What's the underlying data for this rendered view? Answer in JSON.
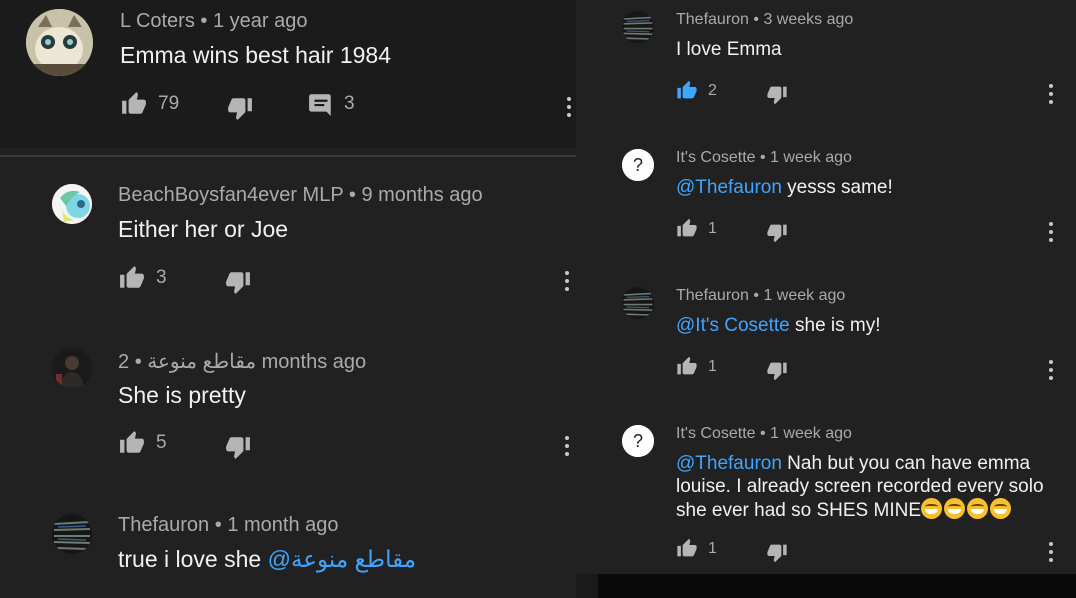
{
  "left": {
    "comments": [
      {
        "author": "L Coters",
        "time": "1 year ago",
        "text": "Emma wins best hair 1984",
        "likes": "79",
        "replies": "3",
        "avatar": "avatar-cat"
      },
      {
        "author": "BeachBoysfan4ever MLP",
        "time": "9 months ago",
        "text": "Either her or Joe",
        "likes": "3",
        "avatar": "avatar-pony"
      },
      {
        "author": "مقاطع منوعة",
        "time": "2 months ago",
        "text": "She is pretty",
        "likes": "5",
        "avatar": "avatar-dark"
      },
      {
        "author": "Thefauron",
        "time": "1 month ago",
        "text": "true i love she ",
        "mention": "@مقاطع منوعة",
        "avatar": "avatar-dark-lines"
      }
    ]
  },
  "right": {
    "comments": [
      {
        "author": "Thefauron",
        "time": "3 weeks ago",
        "text": "I love Emma",
        "likes": "2",
        "liked": true,
        "avatar": "avatar-dark-lines"
      },
      {
        "author": "It's Cosette",
        "time": "1 week ago",
        "mention": "@Thefauron",
        "text": " yesss same!",
        "likes": "1",
        "avatar": "avatar-question"
      },
      {
        "author": "Thefauron",
        "time": "1 week ago",
        "mention": "@It's Cosette",
        "text": " she is my!",
        "likes": "1",
        "avatar": "avatar-dark-lines"
      },
      {
        "author": "It's Cosette",
        "time": "1 week ago",
        "mention": "@Thefauron",
        "text": " Nah but you can have emma",
        "line2": "louise. I already screen recorded every solo",
        "line3": "she ever had so SHES MINE",
        "emoji_count": 4,
        "likes": "1",
        "avatar": "avatar-question"
      }
    ]
  },
  "separator": "•",
  "colors": {
    "background": "#212121",
    "text": "#f1f1f1",
    "meta": "#aaaaaa",
    "link": "#3ea6ff",
    "liked": "#3ea6ff"
  },
  "icons": [
    "thumbs-up-icon",
    "thumbs-down-icon",
    "reply-icon",
    "more-vert-icon"
  ]
}
